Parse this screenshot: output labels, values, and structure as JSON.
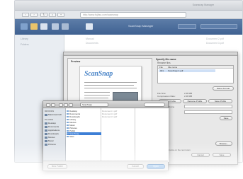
{
  "browser": {
    "window_title": "Scansnap Manager",
    "url": "http://www.fujitsu.com/scansnap",
    "toolbar_title": "ScanSnap Manager",
    "sidebar": [
      "Library",
      "Folders"
    ],
    "bg_rows": [
      "Manual",
      "Documents"
    ],
    "bg_rows_right": [
      "Document 2.pdf",
      "Document 3.pdf"
    ]
  },
  "dialog": {
    "preview_label": "Preview",
    "logo": "ScanSnap",
    "pane_title": "Specify file name",
    "pane_sub": "Rename files",
    "table_headers": [
      "File",
      "File name"
    ],
    "table_row": [
      "001",
      "ScanSnap 3.pdf"
    ],
    "meta_labels": [
      "File Size:",
      "Compression Rate:"
    ],
    "meta_values": [
      "2.48 MB",
      "2.48 MB"
    ],
    "buttons": [
      "Name Format",
      "Load Profile",
      "Rename Profile",
      "Save Profile",
      "Save"
    ],
    "new_folder_label": "New Folder Name",
    "checkbox_text": "Show this window on the next scan",
    "browse_label": "Browse...",
    "cancel_label": "Cancel",
    "save_label": "Save"
  },
  "save_panel": {
    "location": "ScanSnap",
    "sidebar": [
      "DEVICES",
      "Macintosh HD",
      "PLACES",
      "Desktop",
      "Documents",
      "Applications",
      "Downloads",
      "Movies",
      "Music",
      "Pictures"
    ],
    "col1": [
      "Desktop",
      "Documents",
      "Downloads",
      "Library",
      "Movies",
      "Music",
      "Pictures",
      "Public",
      "ScanSnap",
      "Sites"
    ],
    "col2": [
      "Document 1.pdf",
      "Document 2.pdf",
      "Document 3.pdf"
    ],
    "new_folder": "New Folder",
    "cancel": "Cancel",
    "open": "Open"
  },
  "colors": {
    "toolbar": "#4a6d9c",
    "accent": "#3d7fd6",
    "logo": "#4f88c9"
  }
}
